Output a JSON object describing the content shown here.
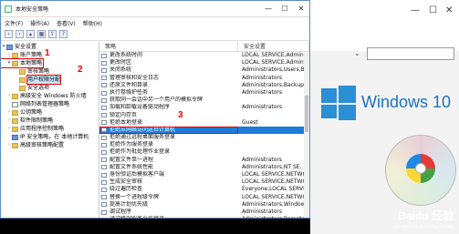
{
  "window": {
    "title": "本地安全策略",
    "menu": [
      "文件(F)",
      "操作(A)",
      "查看(V)",
      "帮助(H)"
    ],
    "toolbar_icons": [
      "back-icon",
      "forward-icon",
      "up-icon",
      "show-hide-tree-icon",
      "export-icon",
      "help-icon"
    ]
  },
  "tree": {
    "root": "安全设置",
    "items": [
      {
        "label": "账户策略",
        "level": 1
      },
      {
        "label": "本地策略",
        "level": 1
      },
      {
        "label": "审核策略",
        "level": 2
      },
      {
        "label": "用户权限分配",
        "level": 2
      },
      {
        "label": "安全选项",
        "level": 2
      },
      {
        "label": "高级安全 Windows 防火墙",
        "level": 1
      },
      {
        "label": "网络列表管理器策略",
        "level": 1
      },
      {
        "label": "公钥策略",
        "level": 1
      },
      {
        "label": "软件限制策略",
        "level": 1
      },
      {
        "label": "应用程序控制策略",
        "level": 1
      },
      {
        "label": "IP 安全策略，在 本地计算机",
        "level": 1
      },
      {
        "label": "高级审核策略配置",
        "level": 1
      }
    ]
  },
  "annotations": {
    "a1": "1",
    "a2": "2",
    "a3": "3"
  },
  "list": {
    "headers": {
      "policy": "策略",
      "setting": "安全设置"
    },
    "rows": [
      {
        "policy": "更改系统时间",
        "setting": "LOCAL SERVICE,Administ..."
      },
      {
        "policy": "更改时区",
        "setting": "LOCAL SERVICE,Administ..."
      },
      {
        "policy": "关闭系统",
        "setting": "Administrators,Users,Ba..."
      },
      {
        "policy": "管理审核和安全日志",
        "setting": "Administrators"
      },
      {
        "policy": "还原文件和目录",
        "setting": "Administrators,Backup..."
      },
      {
        "policy": "执行卷维护任务",
        "setting": "Administrators"
      },
      {
        "policy": "获取同一会话中另一个用户的模拟令牌",
        "setting": ""
      },
      {
        "policy": "加载和卸载设备驱动程序",
        "setting": "Administrators"
      },
      {
        "policy": "锁定内存页",
        "setting": ""
      },
      {
        "policy": "拒绝本地登录",
        "setting": "Guest"
      },
      {
        "policy": "拒绝从网络访问这台计算机",
        "setting": "",
        "selected": true
      },
      {
        "policy": "拒绝通过远程桌面服务登录",
        "setting": ""
      },
      {
        "policy": "拒绝作为服务登录",
        "setting": ""
      },
      {
        "policy": "拒绝作为批处理作业登录",
        "setting": ""
      },
      {
        "policy": "配置文件单一进程",
        "setting": "Administrators"
      },
      {
        "policy": "配置文件系统性能",
        "setting": "Administrators,NT SE..."
      },
      {
        "policy": "身份验证后模拟客户端",
        "setting": "LOCAL SERVICE,NETWO..."
      },
      {
        "policy": "生成安全审核",
        "setting": "LOCAL SERVICE,NETWO..."
      },
      {
        "policy": "绕过遍历检查",
        "setting": "Everyone,LOCAL SERVIC..."
      },
      {
        "policy": "替换一个进程级令牌",
        "setting": "LOCAL SERVICE,NETWO..."
      },
      {
        "policy": "提高计划优先级",
        "setting": "Administrators,Window..."
      },
      {
        "policy": "调试程序",
        "setting": "Administrators"
      },
      {
        "policy": "通过终端服务允许登录",
        "setting": "Administrators,Remote..."
      }
    ]
  },
  "background": {
    "brand_text": "Windows 10",
    "watermark_brand": "Baidu 经验",
    "watermark_url": "jingyan.baidu.com"
  }
}
